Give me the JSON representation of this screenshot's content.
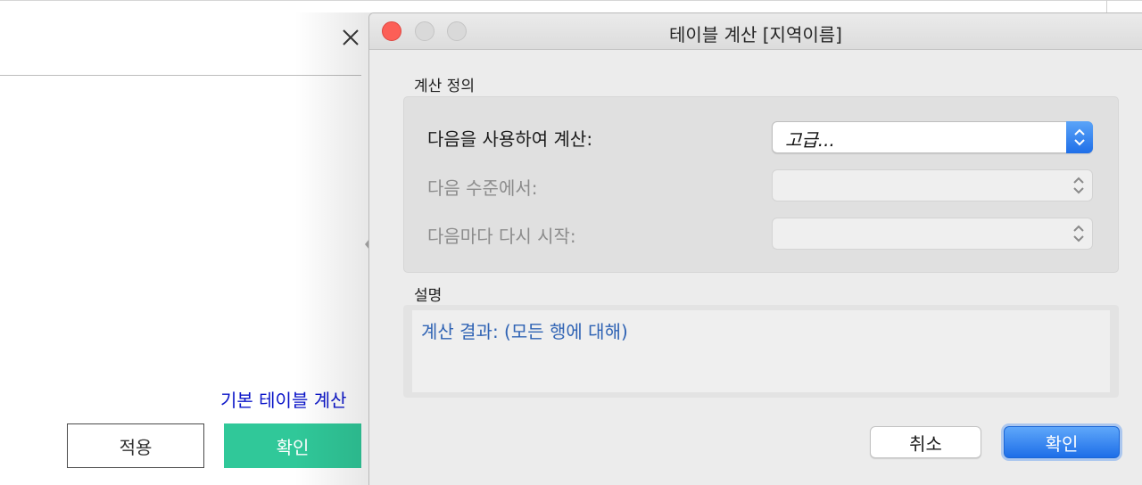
{
  "background_panel": {
    "link_label": "기본 테이블 계산",
    "apply_label": "적용",
    "ok_label": "확인",
    "colors": {
      "ok_button": "#30c899",
      "link": "#0a14c8"
    }
  },
  "dialog": {
    "title": "테이블 계산 [지역이름]",
    "section_definition": "계산 정의",
    "rows": [
      {
        "label": "다음을 사용하여 계산:",
        "value": "고급...",
        "enabled": true
      },
      {
        "label": "다음 수준에서:",
        "value": "",
        "enabled": false
      },
      {
        "label": "다음마다 다시 시작:",
        "value": "",
        "enabled": false
      }
    ],
    "section_description": "설명",
    "description_text": "계산 결과:  (모든 행에 대해)",
    "cancel_label": "취소",
    "confirm_label": "확인",
    "colors": {
      "accent": "#1d6ee8",
      "description_text": "#2f63b4",
      "close_light": "#fc5f57"
    }
  },
  "icons": {
    "background_close": "close-icon",
    "select_arrows": "chevron-up-down-icon"
  }
}
